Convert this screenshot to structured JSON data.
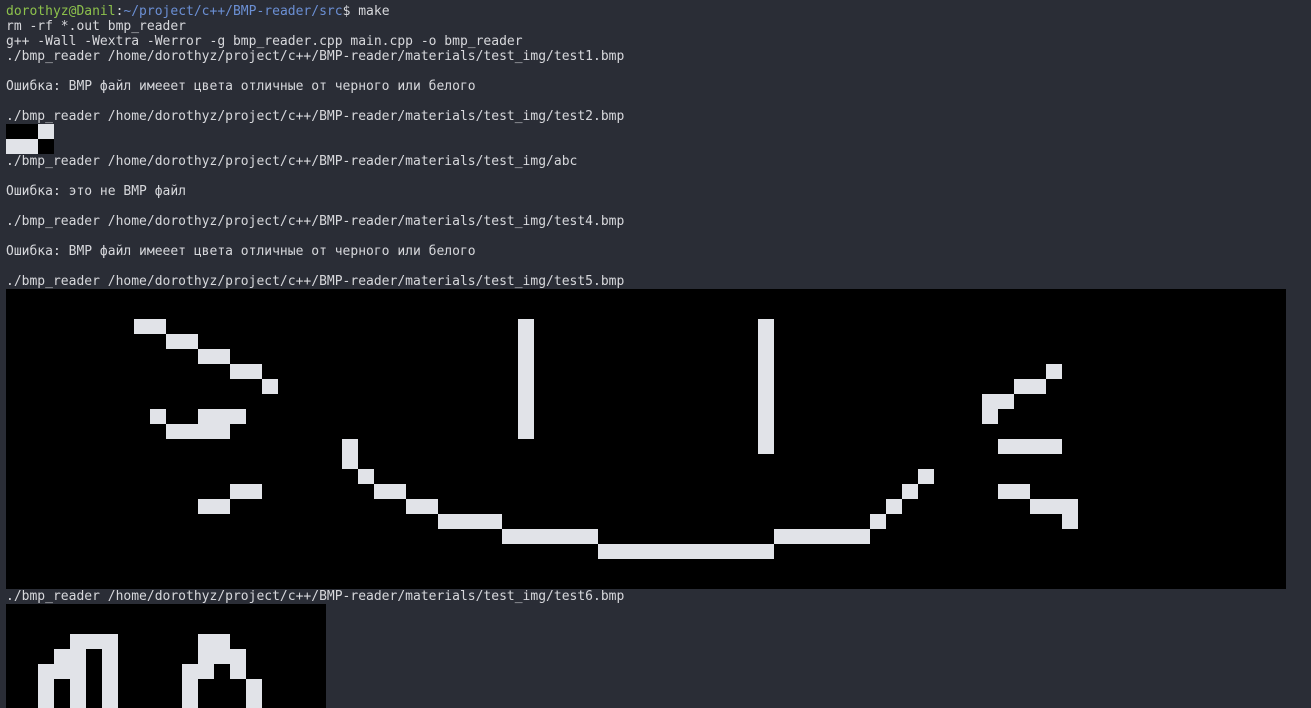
{
  "prompt": {
    "user_host": "dorothyz@Danil",
    "separator": ":",
    "path": "~/project/c++/BMP-reader/src",
    "symbol": "$ ",
    "command": "make"
  },
  "output": {
    "l2": "rm -rf *.out bmp_reader",
    "l3": "g++ -Wall -Wextra -Werror -g bmp_reader.cpp main.cpp -o bmp_reader",
    "l4": "./bmp_reader /home/dorothyz/project/c++/BMP-reader/materials/test_img/test1.bmp",
    "l5": "Ошибка: BMP файл имееет цвета отличные от черного или белого",
    "l6": "./bmp_reader /home/dorothyz/project/c++/BMP-reader/materials/test_img/test2.bmp",
    "l7": "./bmp_reader /home/dorothyz/project/c++/BMP-reader/materials/test_img/abc",
    "l8": "Ошибка: это не BMP файл",
    "l9": "./bmp_reader /home/dorothyz/project/c++/BMP-reader/materials/test_img/test4.bmp",
    "l10": "Ошибка: BMP файл имееет цвета отличные от черного или белого",
    "l11": "./bmp_reader /home/dorothyz/project/c++/BMP-reader/materials/test_img/test5.bmp",
    "l12": "./bmp_reader /home/dorothyz/project/c++/BMP-reader/materials/test_img/test6.bmp"
  },
  "colors": {
    "background": "#2a2d36",
    "text": "#d7d8dc",
    "prompt_user": "#8dc14c",
    "prompt_path": "#6b8fd4",
    "pixel_on": "#e1e3e8",
    "pixel_off": "#000000"
  }
}
